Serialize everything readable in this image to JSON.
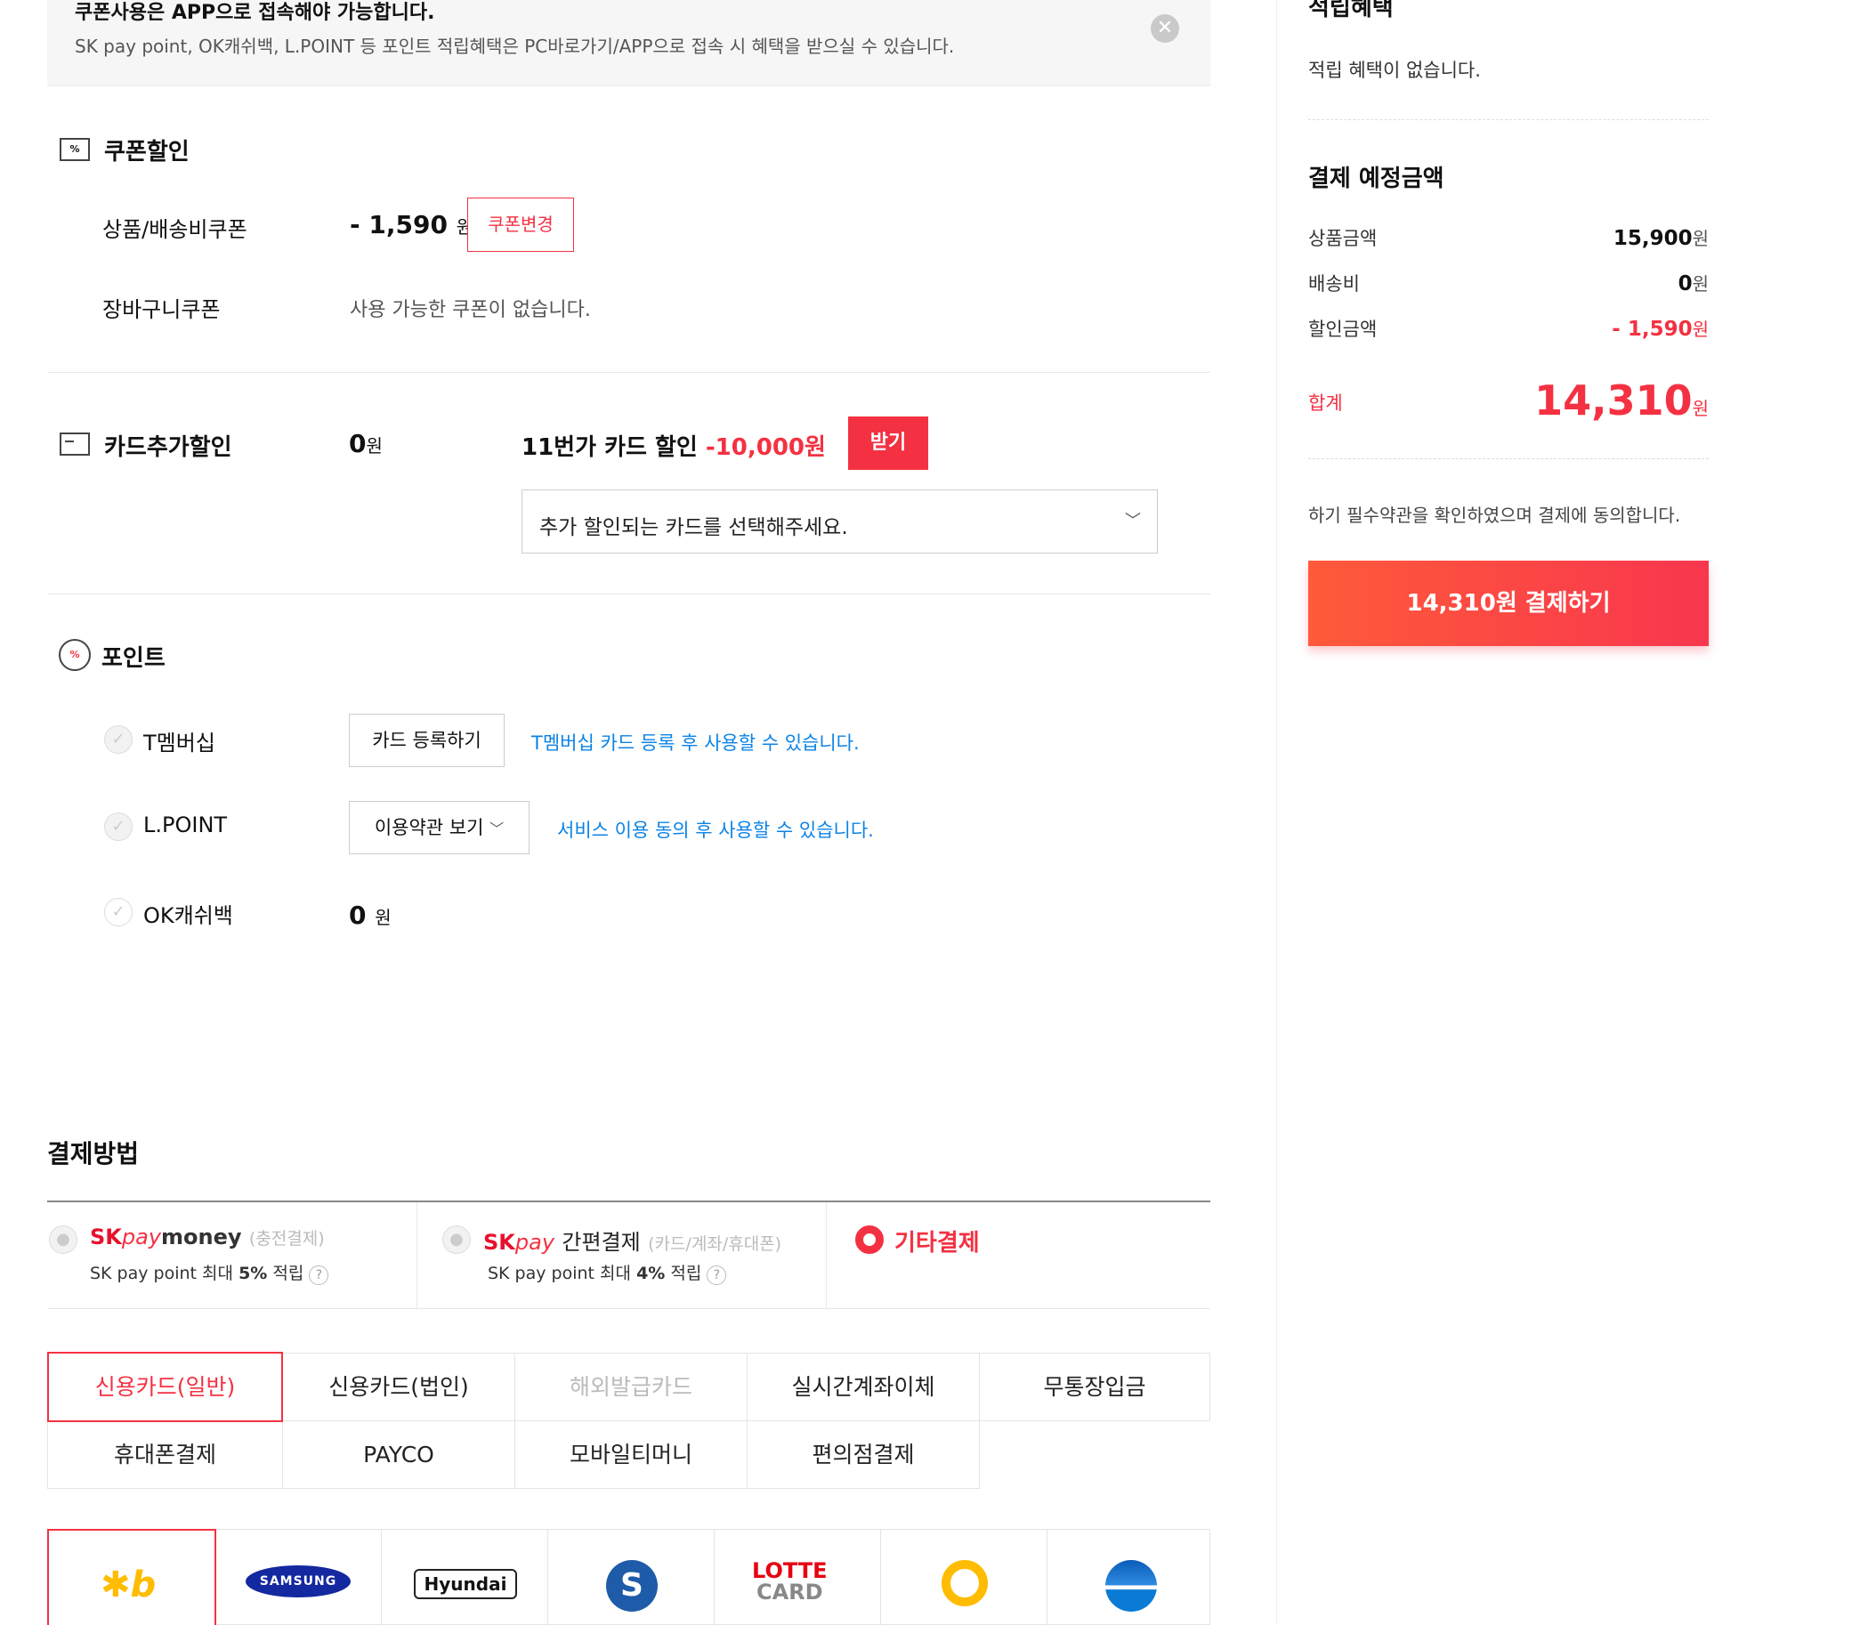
{
  "notice": {
    "title": "쿠폰사용은 APP으로 접속해야 가능합니다.",
    "desc": "SK pay point, OK캐쉬백, L.POINT 등 포인트 적립혜택은 PC바로가기/APP으로 접속 시 혜택을 받으실 수 있습니다."
  },
  "coupon": {
    "title": "쿠폰할인",
    "product_label": "상품/배송비쿠폰",
    "product_amount": "- 1,590",
    "won": "원",
    "change_button": "쿠폰변경",
    "cart_label": "장바구니쿠폰",
    "cart_none": "사용 가능한 쿠폰이 없습니다."
  },
  "card_discount": {
    "title": "카드추가할인",
    "amount": "0",
    "won": "원",
    "offer_text": "11번가 카드 할인",
    "offer_amount": "-10,000원",
    "receive_button": "받기",
    "select_placeholder": "추가 할인되는 카드를 선택해주세요."
  },
  "points": {
    "title": "포인트",
    "items": [
      {
        "label": "T멤버십",
        "button": "카드 등록하기",
        "note": "T멤버십 카드 등록 후 사용할 수 있습니다."
      },
      {
        "label": "L.POINT",
        "button": "이용약관 보기",
        "note": "서비스 이용 동의 후 사용할 수 있습니다."
      },
      {
        "label": "OK캐쉬백",
        "amount": "0",
        "won": "원"
      }
    ]
  },
  "payment": {
    "title": "결제방법",
    "options": [
      {
        "brand_sk": "SK",
        "brand_pay": "pay",
        "brand_extra": "money",
        "sub": "(충전결제)",
        "point": "SK pay point 최대",
        "rate": "5%",
        "point_tail": "적립",
        "selected": false
      },
      {
        "brand_sk": "SK",
        "brand_pay": "pay",
        "brand_extra": "간편결제",
        "sub": "(카드/계좌/휴대폰)",
        "point": "SK pay point 최대",
        "rate": "4%",
        "point_tail": "적립",
        "selected": false
      },
      {
        "label": "기타결제",
        "selected": true
      }
    ],
    "methods_row1": [
      "신용카드(일반)",
      "신용카드(법인)",
      "해외발급카드",
      "실시간계좌이체",
      "무통장입금"
    ],
    "methods_row2": [
      "휴대폰결제",
      "PAYCO",
      "모바일티머니",
      "편의점결제"
    ],
    "active_method": "신용카드(일반)",
    "disabled_method": "해외발급카드",
    "cards": [
      {
        "name": "KB",
        "icon": "kb-logo"
      },
      {
        "name": "SAMSUNG",
        "icon": "samsung-logo"
      },
      {
        "name": "Hyundai",
        "icon": "hyundai-logo"
      },
      {
        "name": "Shinhan",
        "icon": "shinhan-logo"
      },
      {
        "name": "LOTTE CARD",
        "icon": "lotte-logo"
      },
      {
        "name": "NH",
        "icon": "nh-logo"
      },
      {
        "name": "Woori",
        "icon": "woori-logo"
      }
    ]
  },
  "summary": {
    "earn_title": "적립혜택",
    "earn_none": "적립 혜택이 없습니다.",
    "expected_title": "결제 예정금액",
    "rows": [
      {
        "label": "상품금액",
        "value": "15,900"
      },
      {
        "label": "배송비",
        "value": "0"
      },
      {
        "label": "할인금액",
        "value": "- 1,590"
      }
    ],
    "won": "원",
    "total_label": "합계",
    "total_value": "14,310",
    "agree_text": "하기 필수약관을 확인하였으며 결제에 동의합니다.",
    "pay_button": "14,310원 결제하기"
  },
  "colors": {
    "accent": "#f43142",
    "blue": "#0b83e6",
    "lotte": "#e60012",
    "kb": "#ffbc00"
  }
}
